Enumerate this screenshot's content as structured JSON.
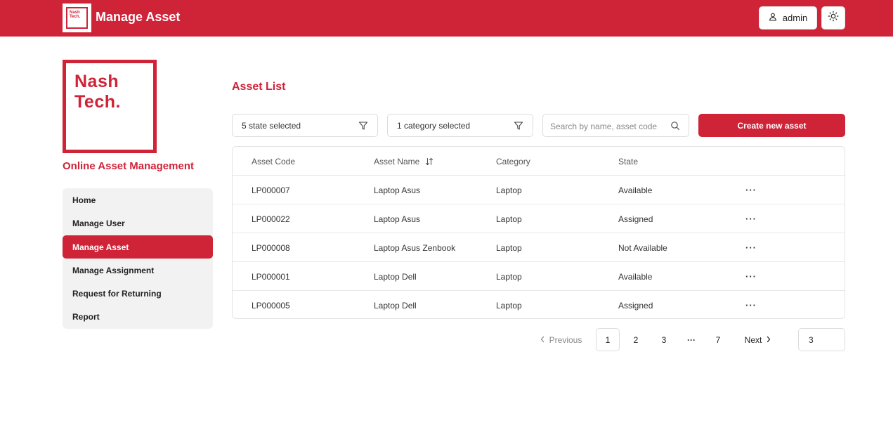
{
  "header": {
    "logo_text_line1": "Nash",
    "logo_text_line2": "Tech.",
    "title": "Manage Asset",
    "user_label": "admin",
    "user_icon": "user-icon",
    "theme_icon": "sun-icon"
  },
  "sidebar": {
    "logo_line1": "Nash",
    "logo_line2": "Tech.",
    "app_name": "Online Asset Management",
    "items": [
      {
        "label": "Home",
        "active": false
      },
      {
        "label": "Manage User",
        "active": false
      },
      {
        "label": "Manage Asset",
        "active": true
      },
      {
        "label": "Manage Assignment",
        "active": false
      },
      {
        "label": "Request for Returning",
        "active": false
      },
      {
        "label": "Report",
        "active": false
      }
    ]
  },
  "main": {
    "title": "Asset List",
    "state_filter": "5 state selected",
    "category_filter": "1 category selected",
    "search_placeholder": "Search by name, asset code",
    "create_button": "Create new asset"
  },
  "table": {
    "headers": [
      "Asset Code",
      "Asset Name",
      "Category",
      "State"
    ],
    "rows": [
      {
        "code": "LP000007",
        "name": "Laptop Asus",
        "category": "Laptop",
        "state": "Available",
        "action": "···"
      },
      {
        "code": "LP000022",
        "name": "Laptop Asus",
        "category": "Laptop",
        "state": "Assigned",
        "action": "···"
      },
      {
        "code": "LP000008",
        "name": "Laptop Asus Zenbook",
        "category": "Laptop",
        "state": "Not Available",
        "action": "···"
      },
      {
        "code": "LP000001",
        "name": "Laptop Dell",
        "category": "Laptop",
        "state": "Available",
        "action": "···"
      },
      {
        "code": "LP000005",
        "name": "Laptop Dell",
        "category": "Laptop",
        "state": "Assigned",
        "action": "···"
      }
    ]
  },
  "pagination": {
    "previous": "Previous",
    "pages": [
      "1",
      "2",
      "3",
      "···",
      "7"
    ],
    "current": "1",
    "next": "Next",
    "goto_value": "3"
  },
  "colors": {
    "brand": "#cf2338"
  }
}
